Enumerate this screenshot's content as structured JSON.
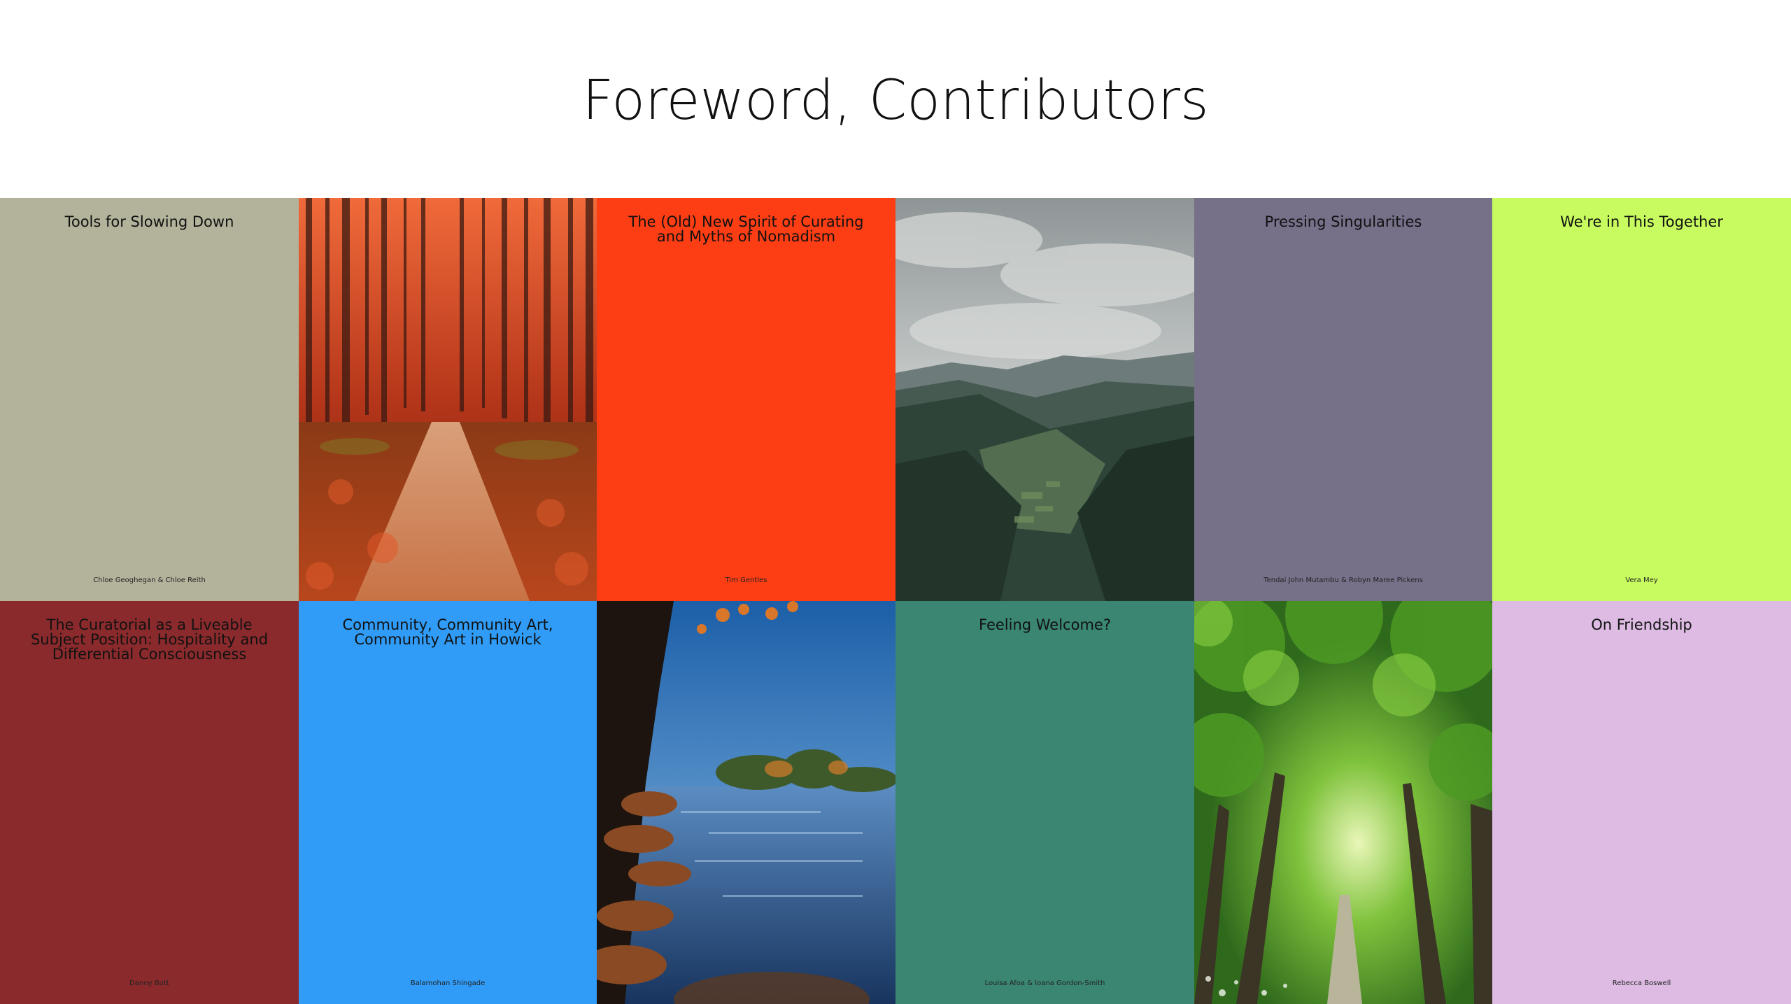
{
  "page": {
    "title": "Foreword, Contributors"
  },
  "tiles": [
    {
      "type": "text",
      "title": "Tools for Slowing Down",
      "author": "Chloe Geoghegan & Chloe Reith",
      "color": "#b3b29a"
    },
    {
      "type": "image",
      "subject": "autumn-forest-path-photo"
    },
    {
      "type": "text",
      "title": "The (Old) New Spirit of Curating and Myths of Nomadism",
      "author": "Tim Gentles",
      "color": "#fd3e15"
    },
    {
      "type": "image",
      "subject": "mountain-valley-photo"
    },
    {
      "type": "text",
      "title": "Pressing Singularities",
      "author": "Tendai John Mutambu & Robyn Maree Pickens",
      "color": "#767089"
    },
    {
      "type": "text",
      "title": "We're in This Together",
      "author": "Vera Mey",
      "color": "#c8fb60"
    },
    {
      "type": "text",
      "title": "The Curatorial as a Liveable Subject Position: Hospitality and Differential Consciousness",
      "author": "Danny Butt",
      "color": "#8a2a2c"
    },
    {
      "type": "text",
      "title": "Community, Community Art, Community Art in Howick",
      "author": "Balamohan Shingade",
      "color": "#309cf7"
    },
    {
      "type": "image",
      "subject": "lake-shore-photo"
    },
    {
      "type": "text",
      "title": "Feeling Welcome?",
      "author": "Louisa Afoa & Ioana Gordon-Smith",
      "color": "#3a8672"
    },
    {
      "type": "image",
      "subject": "green-tree-tunnel-photo"
    },
    {
      "type": "text",
      "title": "On Friendship",
      "author": "Rebecca Boswell",
      "color": "#ddbbe3"
    }
  ]
}
